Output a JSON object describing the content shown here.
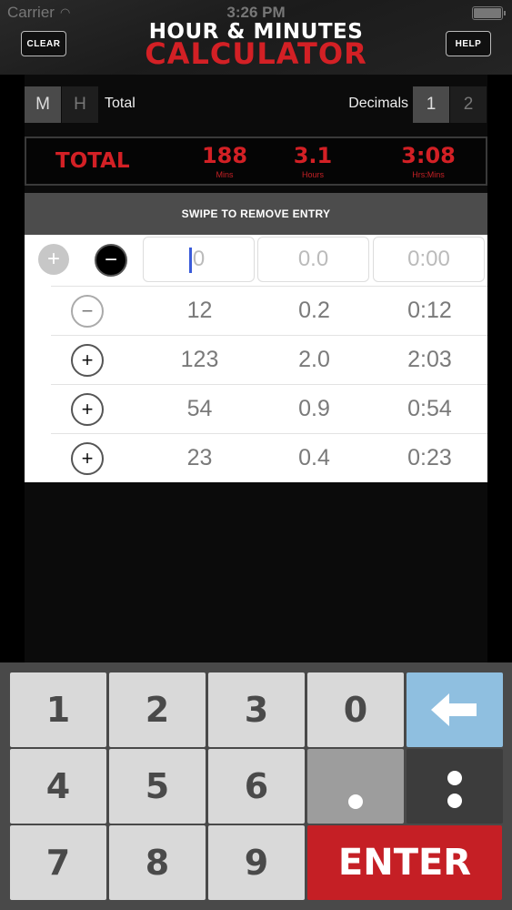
{
  "status": {
    "carrier": "Carrier",
    "time": "3:26 PM"
  },
  "header": {
    "clear_label": "CLEAR",
    "help_label": "HELP",
    "title_line1": "HOUR & MINUTES",
    "title_line2": "CALCULATOR"
  },
  "mode": {
    "m_label": "M",
    "h_label": "H",
    "total_label": "Total",
    "selected": "M"
  },
  "decimals": {
    "label": "Decimals",
    "options": [
      "1",
      "2"
    ],
    "selected": "1"
  },
  "totals": {
    "label": "TOTAL",
    "mins": {
      "value": "188",
      "unit": "Mins"
    },
    "hours": {
      "value": "3.1",
      "unit": "Hours"
    },
    "hrsmins": {
      "value": "3:08",
      "unit": "Hrs:Mins"
    }
  },
  "swipe_hint": "SWIPE TO REMOVE ENTRY",
  "input": {
    "mins_placeholder": "0",
    "hours_placeholder": "0.0",
    "hm_placeholder": "0:00"
  },
  "entries": [
    {
      "sign": "−",
      "mins": "12",
      "hours": "0.2",
      "hm": "0:12"
    },
    {
      "sign": "+",
      "mins": "123",
      "hours": "2.0",
      "hm": "2:03"
    },
    {
      "sign": "+",
      "mins": "54",
      "hours": "0.9",
      "hm": "0:54"
    },
    {
      "sign": "+",
      "mins": "23",
      "hours": "0.4",
      "hm": "0:23"
    }
  ],
  "keypad": {
    "k1": "1",
    "k2": "2",
    "k3": "3",
    "k0": "0",
    "k4": "4",
    "k5": "5",
    "k6": "6",
    "k7": "7",
    "k8": "8",
    "k9": "9",
    "enter": "ENTER",
    "back_icon": "left-arrow-icon"
  },
  "colors": {
    "accent_red": "#d32025",
    "backspace_blue": "#8fbfe0"
  }
}
